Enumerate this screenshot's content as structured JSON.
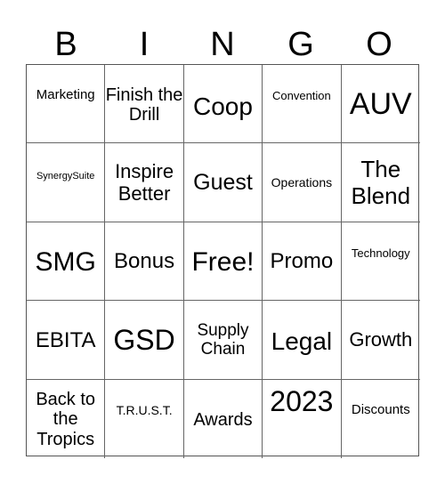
{
  "header": [
    "B",
    "I",
    "N",
    "G",
    "O"
  ],
  "cells": [
    [
      {
        "text": "Marketing"
      },
      {
        "text": "Finish the Drill"
      },
      {
        "text": "Coop"
      },
      {
        "text": "Convention"
      },
      {
        "text": "AUV"
      }
    ],
    [
      {
        "text": "SynergySuite"
      },
      {
        "text": "Inspire Better"
      },
      {
        "text": "Guest"
      },
      {
        "text": "Operations"
      },
      {
        "text": "The Blend"
      }
    ],
    [
      {
        "text": "SMG"
      },
      {
        "text": "Bonus"
      },
      {
        "text": "Free!"
      },
      {
        "text": "Promo"
      },
      {
        "text": "Technology"
      }
    ],
    [
      {
        "text": "EBITA"
      },
      {
        "text": "GSD"
      },
      {
        "text": "Supply Chain"
      },
      {
        "text": "Legal"
      },
      {
        "text": "Growth"
      }
    ],
    [
      {
        "text": "Back to the Tropics"
      },
      {
        "text": "T.R.U.S.T."
      },
      {
        "text": "Awards"
      },
      {
        "text": "2023"
      },
      {
        "text": "Discounts"
      }
    ]
  ]
}
